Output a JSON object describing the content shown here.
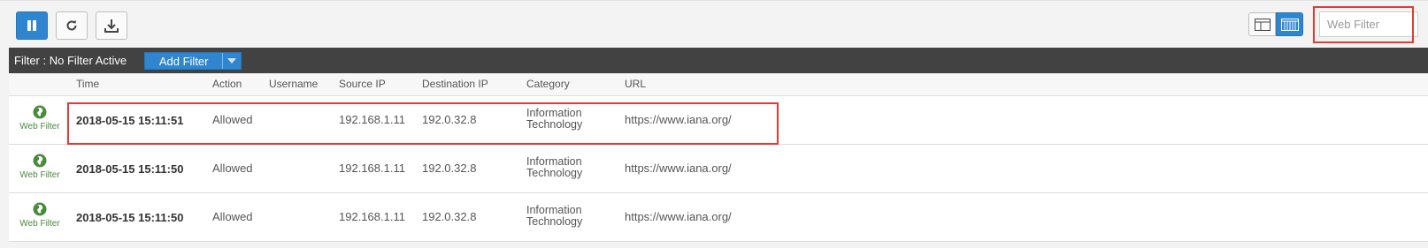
{
  "toolbar": {
    "pause_icon": "pause-icon",
    "refresh_icon": "refresh-icon",
    "download_icon": "download-icon",
    "view_split_icon": "split-view-icon",
    "view_grid_icon": "grid-view-icon",
    "search_placeholder": "Web Filter",
    "accent_color": "#2f86cf"
  },
  "filterbar": {
    "label": "Filter : No Filter Active",
    "add_filter_label": "Add Filter"
  },
  "table": {
    "columns": [
      "Time",
      "Action",
      "Username",
      "Source IP",
      "Destination IP",
      "Category",
      "URL"
    ],
    "rows": [
      {
        "module": "Web Filter",
        "time": "2018-05-15 15:11:51",
        "action": "Allowed",
        "username": "",
        "source_ip": "192.168.1.11",
        "destination_ip": "192.0.32.8",
        "category_line1": "Information",
        "category_line2": "Technology",
        "url": "https://www.iana.org/"
      },
      {
        "module": "Web Filter",
        "time": "2018-05-15 15:11:50",
        "action": "Allowed",
        "username": "",
        "source_ip": "192.168.1.11",
        "destination_ip": "192.0.32.8",
        "category_line1": "Information",
        "category_line2": "Technology",
        "url": "https://www.iana.org/"
      },
      {
        "module": "Web Filter",
        "time": "2018-05-15 15:11:50",
        "action": "Allowed",
        "username": "",
        "source_ip": "192.168.1.11",
        "destination_ip": "192.0.32.8",
        "category_line1": "Information",
        "category_line2": "Technology",
        "url": "https://www.iana.org/"
      }
    ]
  },
  "highlight_color": "#e53935"
}
